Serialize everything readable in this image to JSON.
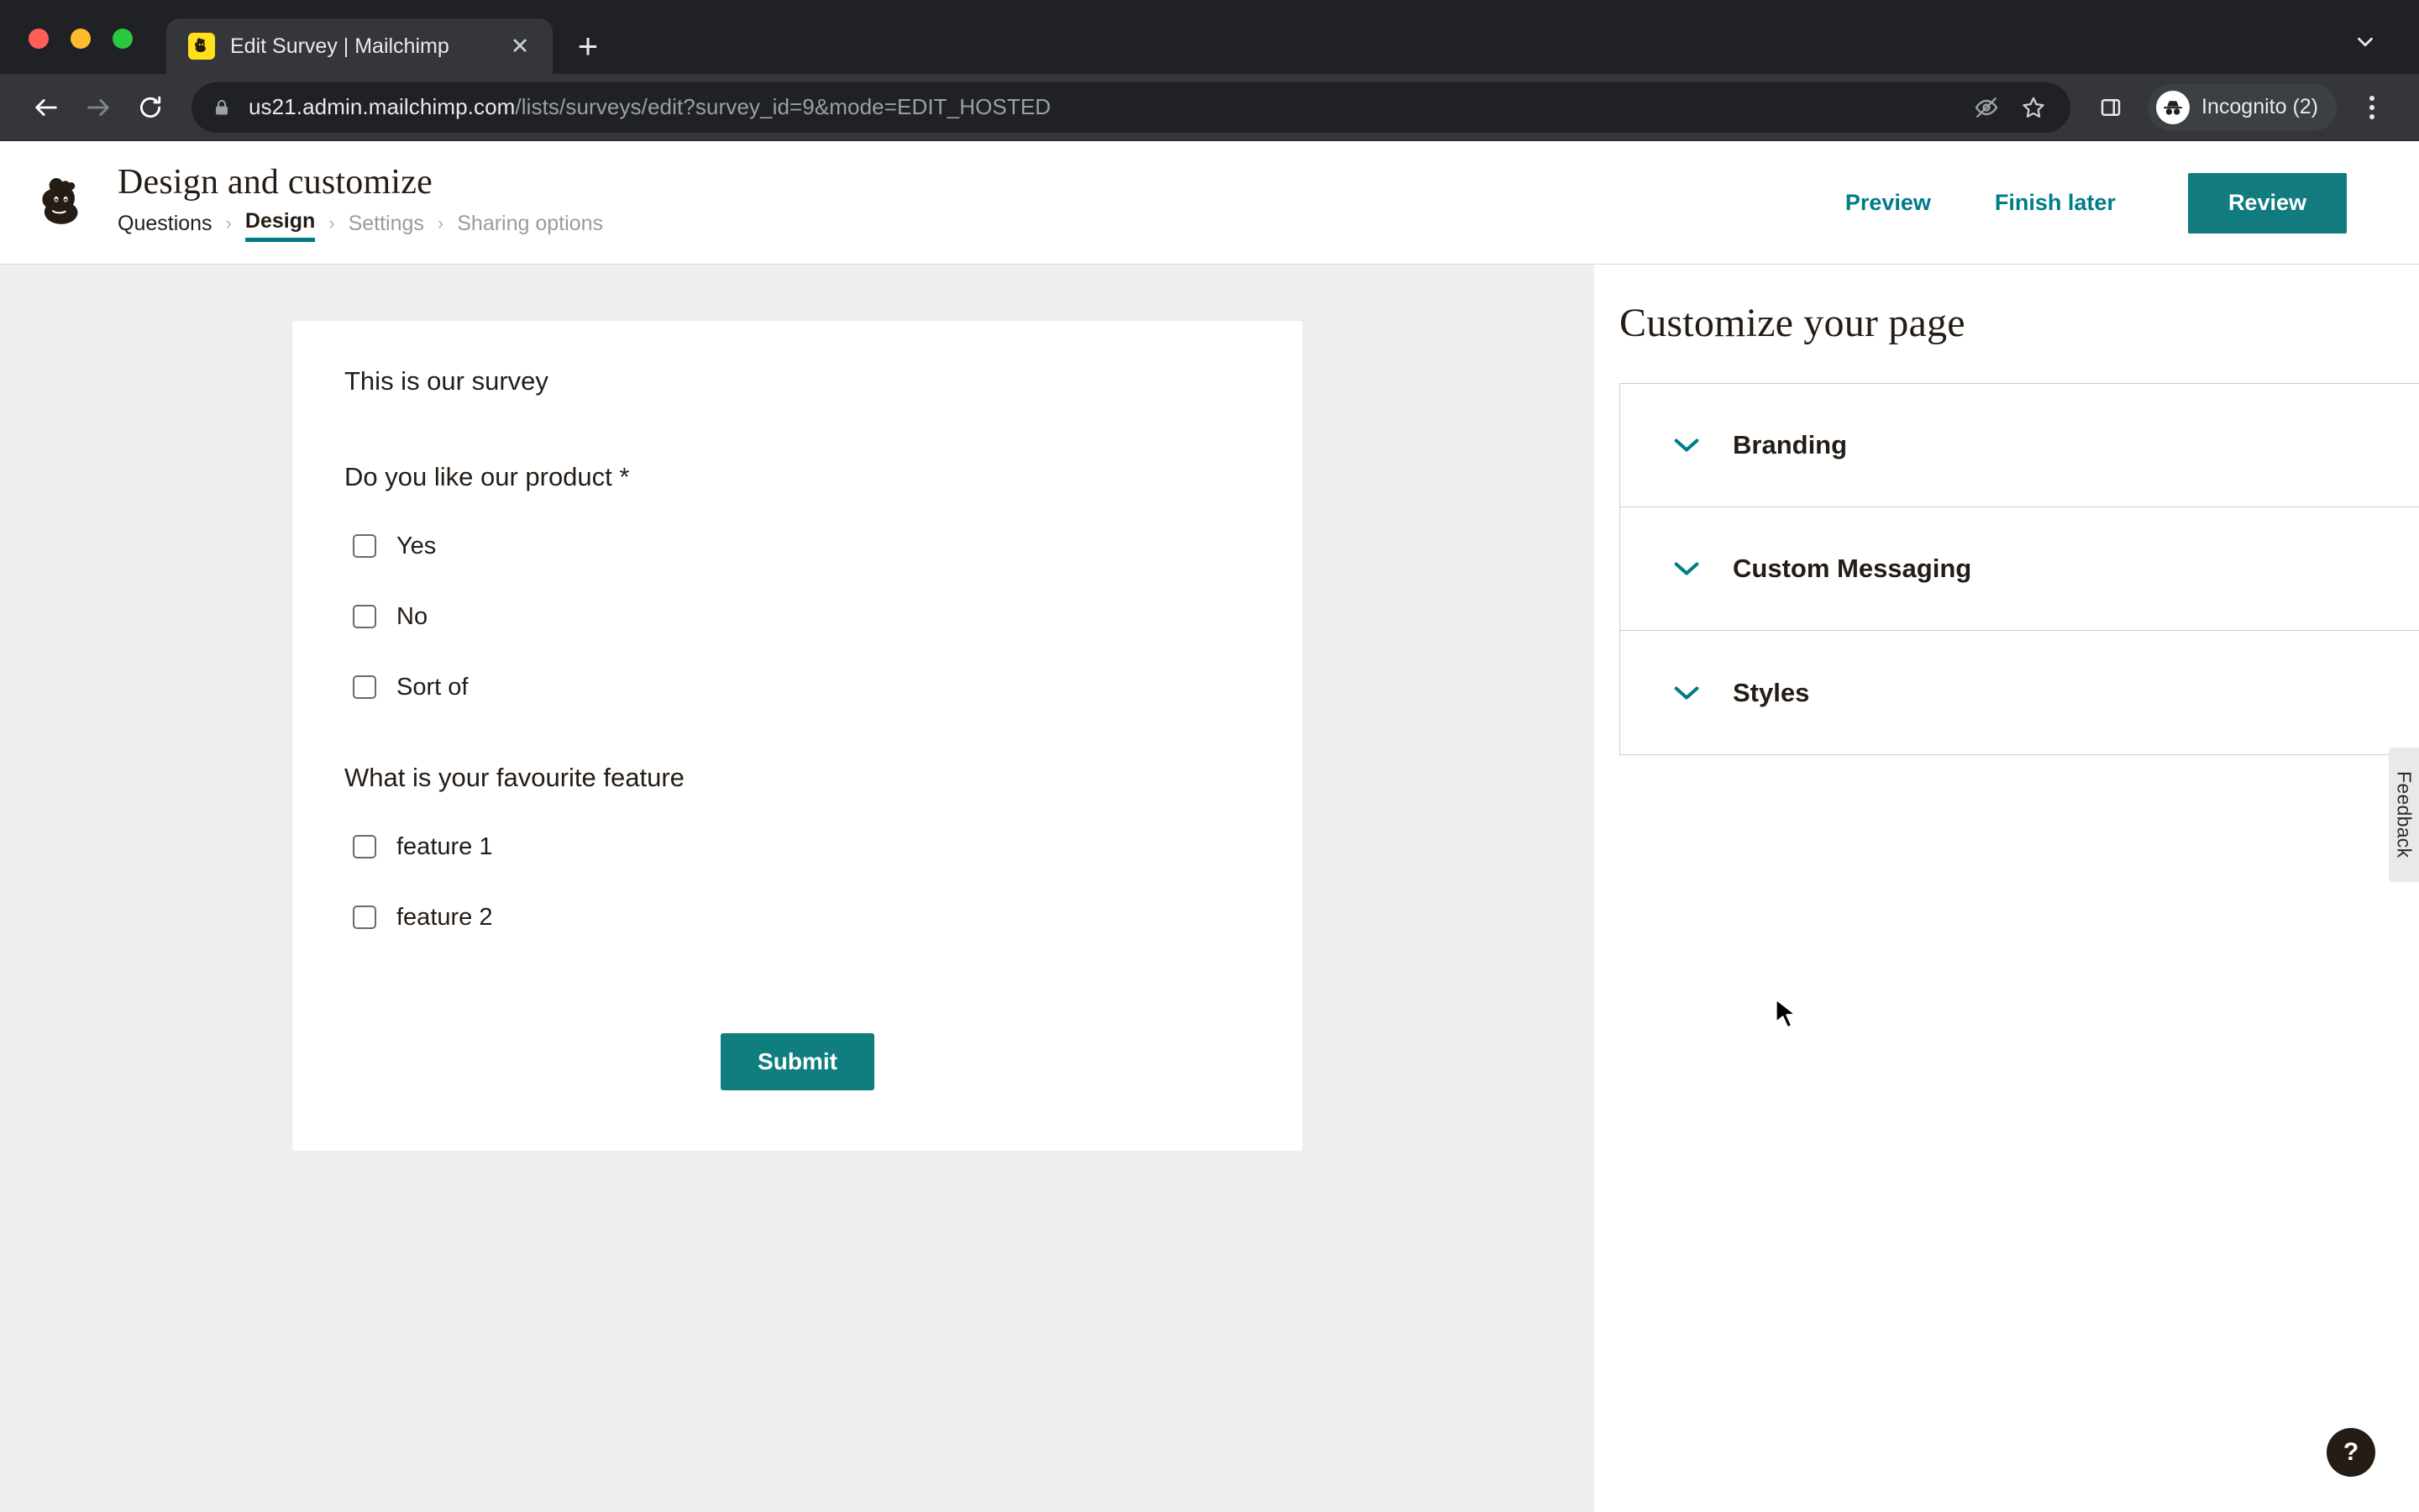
{
  "browser": {
    "tab": {
      "title": "Edit Survey | Mailchimp",
      "favicon_name": "mailchimp-favicon",
      "close_label": "✕"
    },
    "new_tab_label": "+",
    "tabstrip_expand_label": "⌄",
    "toolbar": {
      "back_label": "back-arrow",
      "forward_label": "forward-arrow",
      "reload_label": "reload",
      "url_host": "us21.admin.mailchimp.com",
      "url_path": "/lists/surveys/edit?survey_id=9&mode=EDIT_HOSTED",
      "url_full": "us21.admin.mailchimp.com/lists/surveys/edit?survey_id=9&mode=EDIT_HOSTED",
      "lock_icon": "lock-icon",
      "tracking_protection_icon": "eye-slash-icon",
      "bookmark_icon": "star-icon",
      "side_panel_icon": "side-panel-icon",
      "profile_label": "Incognito (2)",
      "profile_icon": "incognito-icon",
      "menu_icon": "kebab-menu-icon"
    }
  },
  "app": {
    "header": {
      "logo_name": "mailchimp-freddie-logo",
      "title": "Design and customize",
      "breadcrumb": [
        {
          "label": "Questions",
          "state": "link"
        },
        {
          "label": "Design",
          "state": "active"
        },
        {
          "label": "Settings",
          "state": "muted"
        },
        {
          "label": "Sharing options",
          "state": "muted"
        }
      ],
      "breadcrumb_separator": "›",
      "actions": {
        "preview": "Preview",
        "finish_later": "Finish later",
        "review": "Review"
      }
    },
    "survey": {
      "title": "This is our survey",
      "questions": [
        {
          "label": "Do you like our product *",
          "options": [
            "Yes",
            "No",
            "Sort of"
          ]
        },
        {
          "label": "What is your favourite feature",
          "options": [
            "feature 1",
            "feature 2"
          ]
        }
      ],
      "submit_label": "Submit"
    },
    "sidebar": {
      "title": "Customize your page",
      "sections": [
        {
          "label": "Branding",
          "chevron": "chevron-down-icon"
        },
        {
          "label": "Custom Messaging",
          "chevron": "chevron-down-icon"
        },
        {
          "label": "Styles",
          "chevron": "chevron-down-icon"
        }
      ]
    },
    "feedback_tab_label": "Feedback",
    "help_button_label": "?"
  },
  "colors": {
    "accent_teal": "#007c89",
    "button_teal": "#117b80",
    "brand_yellow": "#ffe01b",
    "canvas_gray": "#efeff0",
    "text_dark": "#241c15"
  }
}
